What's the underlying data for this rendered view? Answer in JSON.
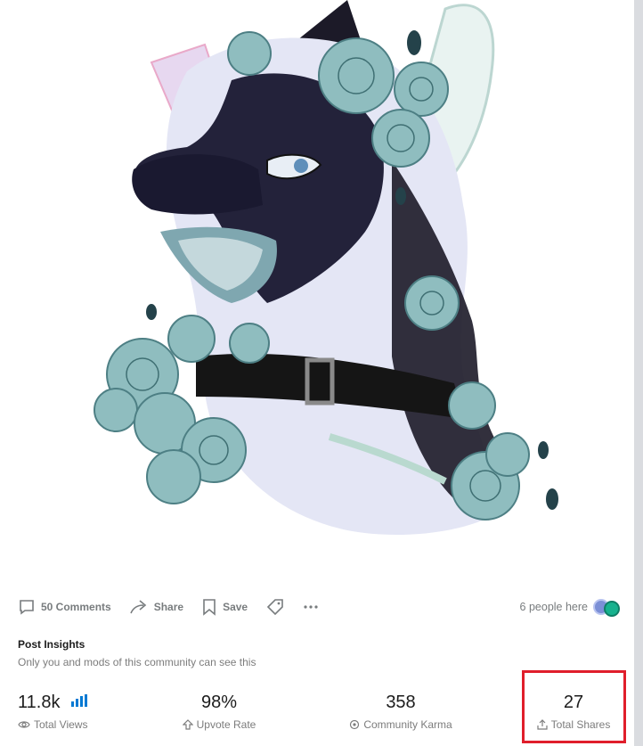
{
  "post": {
    "comments_label": "50 Comments",
    "share_label": "Share",
    "save_label": "Save",
    "presence_text": "6 people here"
  },
  "insights": {
    "title": "Post Insights",
    "subtitle": "Only you and mods of this community can see this",
    "stats": {
      "views": {
        "value": "11.8k",
        "label": "Total Views"
      },
      "upvote": {
        "value": "98%",
        "label": "Upvote Rate"
      },
      "karma": {
        "value": "358",
        "label": "Community Karma"
      },
      "shares": {
        "value": "27",
        "label": "Total Shares"
      }
    }
  },
  "colors": {
    "highlight": "#e01e2b",
    "accent": "#0079d3",
    "muted": "#787c7e",
    "rose": "#8fbdbf"
  },
  "icons": [
    "comment-icon",
    "share-icon",
    "save-icon",
    "tag-icon",
    "more-icon",
    "bar-chart-icon",
    "eye-icon",
    "upvote-icon",
    "karma-icon",
    "share-upload-icon"
  ]
}
